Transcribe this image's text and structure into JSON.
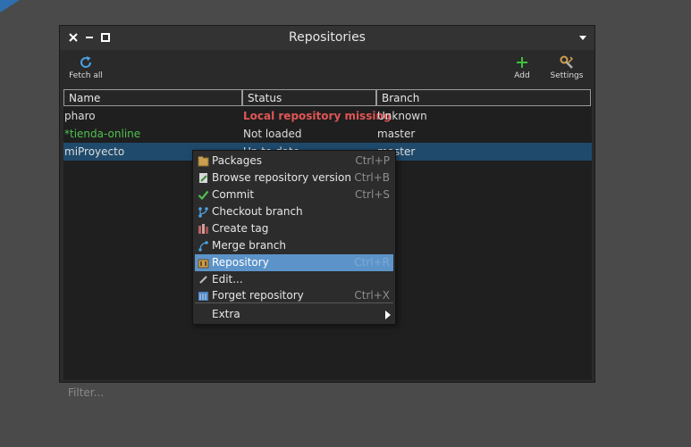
{
  "window": {
    "title": "Repositories",
    "close_icon": "close-icon",
    "minimize_icon": "minimize-icon",
    "maximize_icon": "maximize-icon",
    "menu_icon": "window-menu-icon"
  },
  "toolbar": {
    "fetch_all_label": "Fetch all",
    "add_label": "Add",
    "settings_label": "Settings"
  },
  "table": {
    "columns": [
      "Name",
      "Status",
      "Branch"
    ],
    "rows": [
      {
        "name": "pharo",
        "status": "Local repository missing",
        "branch": "Unknown"
      },
      {
        "name": "*tienda-online",
        "status": "Not loaded",
        "branch": "master"
      },
      {
        "name": "miProyecto",
        "status": "Up to date",
        "branch": "master",
        "selected": true
      }
    ],
    "filter_placeholder": "Filter..."
  },
  "context_menu": {
    "items": [
      {
        "label": "Packages",
        "shortcut": "Ctrl+P",
        "icon": "packages-icon"
      },
      {
        "label": "Browse repository version",
        "shortcut": "Ctrl+B",
        "icon": "browse-icon"
      },
      {
        "label": "Commit",
        "shortcut": "Ctrl+S",
        "icon": "check-icon"
      },
      {
        "label": "Checkout branch",
        "shortcut": "",
        "icon": "branch-icon"
      },
      {
        "label": "Create tag",
        "shortcut": "",
        "icon": "tag-icon"
      },
      {
        "label": "Merge branch",
        "shortcut": "",
        "icon": "merge-icon"
      },
      {
        "label": "Repository",
        "shortcut": "Ctrl+R",
        "icon": "repository-icon",
        "active": true
      },
      {
        "label": "Edit...",
        "shortcut": "",
        "icon": "edit-icon"
      },
      {
        "label": "Forget repository",
        "shortcut": "Ctrl+X",
        "icon": "forget-icon"
      },
      {
        "label": "Extra",
        "shortcut": "",
        "icon": "submenu-arrow-icon"
      }
    ]
  },
  "colors": {
    "background": "#4a4a4a",
    "window": "#2a2a2a",
    "selection": "#1f4a6b",
    "menu_highlight": "#5c93c9",
    "error": "#e05555",
    "dirty": "#4fc04f"
  }
}
